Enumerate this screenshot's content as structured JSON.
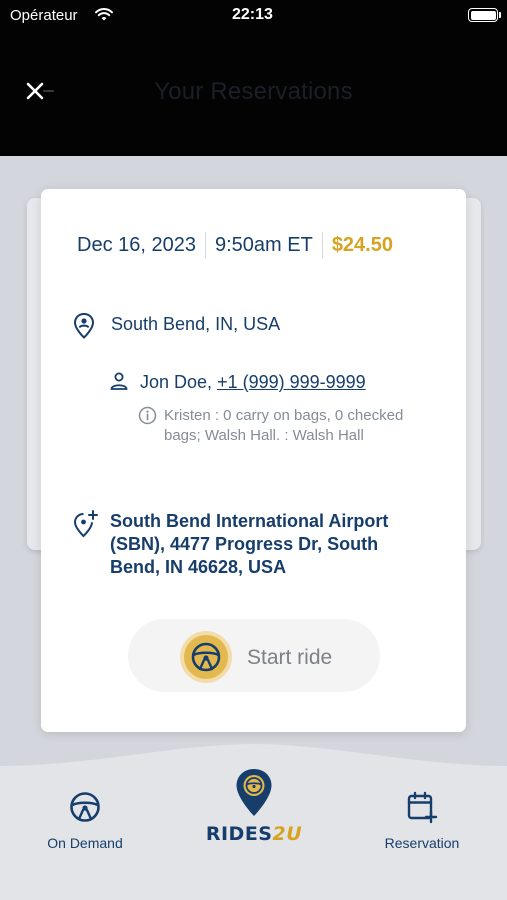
{
  "status_bar": {
    "carrier": "Opérateur",
    "time": "22:13"
  },
  "header": {
    "title": "Your Reservations"
  },
  "reservation": {
    "date": "Dec 16, 2023",
    "time": "9:50am ET",
    "price": "$24.50",
    "pickup": "South Bend, IN, USA",
    "passenger_name": "Jon Doe,",
    "passenger_phone": "+1 (999) 999-9999",
    "notes": "Kristen : 0 carry on bags, 0 checked bags; Walsh Hall.  : Walsh Hall",
    "dropoff": "South Bend International Airport (SBN), 4477 Progress Dr, South Bend, IN 46628, USA",
    "start_label": "Start ride"
  },
  "nav": {
    "on_demand": "On Demand",
    "logo_main": "RIDES",
    "logo_accent": "2U",
    "reservation": "Reservation"
  },
  "colors": {
    "navy": "#173e6b",
    "gold": "#d8a320"
  },
  "icons": [
    "wifi-icon",
    "battery-icon",
    "close-icon",
    "pickup-pin-icon",
    "person-icon",
    "info-icon",
    "dropoff-pin-icon",
    "steering-wheel-icon",
    "calendar-plus-icon"
  ]
}
